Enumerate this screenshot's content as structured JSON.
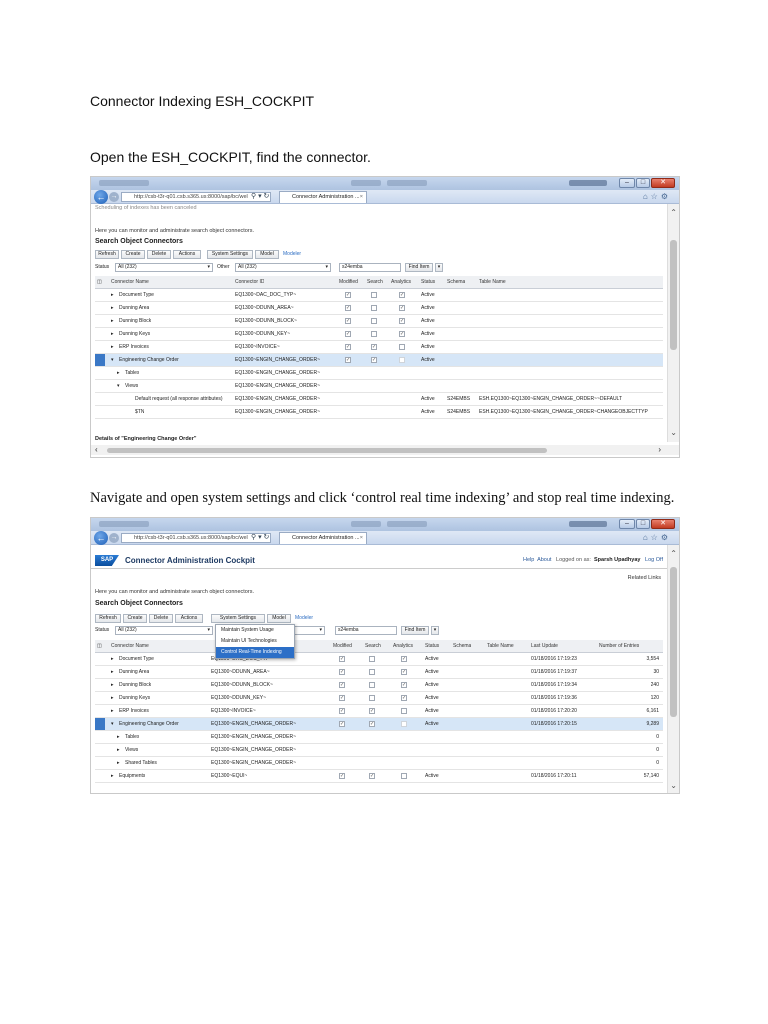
{
  "doc": {
    "heading": "Connector Indexing ESH_COCKPIT",
    "step1": "Open the ESH_COCKPIT, find the connector.",
    "step2": "Navigate and open system settings and click ‘control real time indexing’ and stop real time indexing."
  },
  "browser": {
    "url": "http://csb-t3r-q01.csb.s365.us:8000/sap/bc/wel",
    "tab_label": "Connector Administration ...",
    "tab_close": "×"
  },
  "shot1": {
    "status_msg": "Scheduling of indexes has been canceled",
    "intro": "Here you can monitor and administrate search object connectors.",
    "section_title": "Search Object Connectors",
    "toolbar": {
      "refresh": "Refresh",
      "create": "Create",
      "delete": "Delete",
      "actions": "Actions",
      "system_settings": "System Settings",
      "model": "Model",
      "modeler": "Modeler"
    },
    "filter": {
      "status_label": "Status",
      "status_value": "All (232)",
      "other_label": "Other",
      "other_value": "All (232)",
      "search_value": "s24emba",
      "find_item": "Find Item"
    },
    "columns": {
      "name": "Connector Name",
      "id": "Connector ID",
      "modified": "Modified",
      "search": "Search",
      "analytics": "Analytics",
      "status": "Status",
      "schema": "Schema",
      "table": "Table Name"
    },
    "rows": [
      {
        "name": "Document Type",
        "id": "EQ1300~DAC_DOC_TYP~",
        "status": "Active",
        "schema": "",
        "table": ""
      },
      {
        "name": "Dunning Area",
        "id": "EQ1300~DDUNN_AREA~",
        "status": "Active",
        "schema": "",
        "table": ""
      },
      {
        "name": "Dunning Block",
        "id": "EQ1300~DDUNN_BLOCK~",
        "status": "Active",
        "schema": "",
        "table": ""
      },
      {
        "name": "Dunning Keys",
        "id": "EQ1300~DDUNN_KEY~",
        "status": "Active",
        "schema": "",
        "table": ""
      },
      {
        "name": "ERP Invoices",
        "id": "EQ1300~INVOICE~",
        "status": "Active",
        "schema": "",
        "table": ""
      },
      {
        "name": "Engineering Change Order",
        "id": "EQ1300~ENGIN_CHANGE_ORDER~",
        "status": "Active",
        "schema": "",
        "table": ""
      },
      {
        "name": "Tables",
        "id": "EQ1300~ENGIN_CHANGE_ORDER~",
        "status": "",
        "schema": "",
        "table": ""
      },
      {
        "name": "Views",
        "id": "EQ1300~ENGIN_CHANGE_ORDER~",
        "status": "",
        "schema": "",
        "table": ""
      },
      {
        "name": "Default request (all response attributes)",
        "id": "EQ1300~ENGIN_CHANGE_ORDER~",
        "status": "Active",
        "schema": "S24EMBS",
        "table": "ESH.EQ1300~EQ1300~ENGIN_CHANGE_ORDER~~DEFAULT"
      },
      {
        "name": "$TN",
        "id": "EQ1300~ENGIN_CHANGE_ORDER~",
        "status": "Active",
        "schema": "S24EMBS",
        "table": "ESH.EQ1300~EQ1300~ENGIN_CHANGE_ORDER~CHANGEOBJECTTYP"
      }
    ],
    "details": "Details of \"Engineering Change Order\""
  },
  "shot2": {
    "app_title": "Connector Administration Cockpit",
    "help": "Help",
    "about": "About",
    "logged_on_as": "Logged on as:",
    "user": "Sparsh Upadhyay",
    "logoff": "Log Off",
    "related_links": "Related Links",
    "intro": "Here you can monitor and administrate search object connectors.",
    "section_title": "Search Object Connectors",
    "toolbar": {
      "refresh": "Refresh",
      "create": "Create",
      "delete": "Delete",
      "actions": "Actions",
      "system_settings": "System Settings",
      "model": "Model",
      "modeler": "Modeler"
    },
    "menu": [
      "Maintain System Usage",
      "Maintain UI Technologies",
      "Control Real-Time Indexing"
    ],
    "filter": {
      "status_label": "Status",
      "status_value": "All (232)",
      "search_value": "s24emba",
      "find_item": "Find Item"
    },
    "columns": {
      "name": "Connector Name",
      "modified": "Modified",
      "search": "Search",
      "analytics": "Analytics",
      "status": "Status",
      "schema": "Schema",
      "table": "Table Name",
      "last_update": "Last Update",
      "entries": "Number of Entries"
    },
    "rows": [
      {
        "name": "Document Type",
        "id": "EQ1300~DAC_DOC_TYP~",
        "status": "Active",
        "last_update": "01/18/2016 17:19:23",
        "entries": "3,554"
      },
      {
        "name": "Dunning Area",
        "id": "EQ1300~DDUNN_AREA~",
        "status": "Active",
        "last_update": "01/18/2016 17:19:37",
        "entries": "30"
      },
      {
        "name": "Dunning Block",
        "id": "EQ1300~DDUNN_BLOCK~",
        "status": "Active",
        "last_update": "01/18/2016 17:19:34",
        "entries": "240"
      },
      {
        "name": "Dunning Keys",
        "id": "EQ1300~DDUNN_KEY~",
        "status": "Active",
        "last_update": "01/18/2016 17:19:36",
        "entries": "120"
      },
      {
        "name": "ERP Invoices",
        "id": "EQ1300~INVOICE~",
        "status": "Active",
        "last_update": "01/18/2016 17:20:20",
        "entries": "6,161"
      },
      {
        "name": "Engineering Change Order",
        "id": "EQ1300~ENGIN_CHANGE_ORDER~",
        "status": "Active",
        "last_update": "01/18/2016 17:20:15",
        "entries": "9,289"
      },
      {
        "name": "Tables",
        "id": "EQ1300~ENGIN_CHANGE_ORDER~",
        "status": "",
        "last_update": "",
        "entries": "0"
      },
      {
        "name": "Views",
        "id": "EQ1300~ENGIN_CHANGE_ORDER~",
        "status": "",
        "last_update": "",
        "entries": "0"
      },
      {
        "name": "Shared Tables",
        "id": "EQ1300~ENGIN_CHANGE_ORDER~",
        "status": "",
        "last_update": "",
        "entries": "0"
      },
      {
        "name": "Equipments",
        "id": "EQ1300~EQUI~",
        "status": "Active",
        "last_update": "01/18/2016 17:20:11",
        "entries": "57,140"
      }
    ]
  },
  "colors": {
    "selected_row": "#d6e6f7",
    "row_marker": "#3a78c6",
    "menu_active": "#2c6fc7",
    "link": "#2b6cc2"
  }
}
